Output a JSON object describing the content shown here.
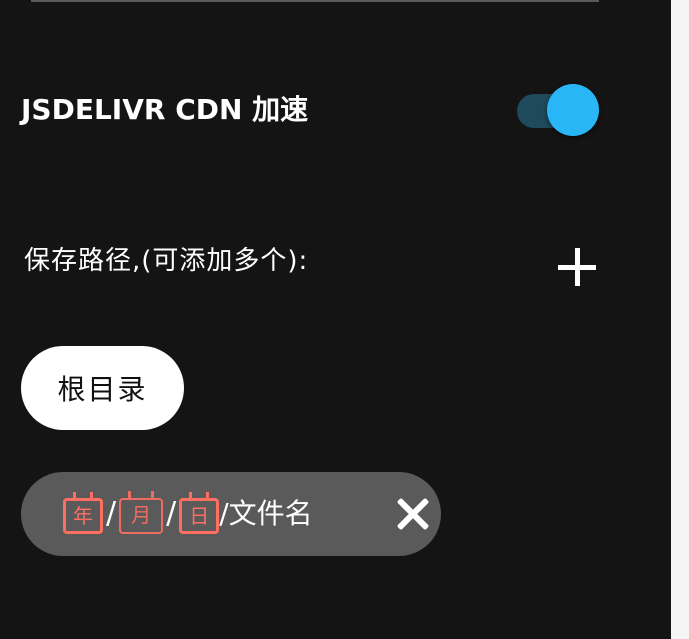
{
  "cdn": {
    "label": "JSDELIVR CDN 加速",
    "enabled": true
  },
  "save_path": {
    "label": "保存路径,(可添加多个):",
    "add_icon": "plus-icon"
  },
  "paths": [
    {
      "label": "根目录"
    },
    {
      "segments": {
        "year": "年",
        "month": "月",
        "day": "日",
        "slash": "/",
        "filename": "/文件名"
      },
      "remove_icon": "close-icon"
    }
  ],
  "colors": {
    "background": "#141414",
    "toggle_thumb": "#29b6f6",
    "toggle_track": "#1e4a5c",
    "date_tag": "#ff6f61",
    "chip_dark": "#5a5a5a",
    "chip_light": "#ffffff"
  }
}
